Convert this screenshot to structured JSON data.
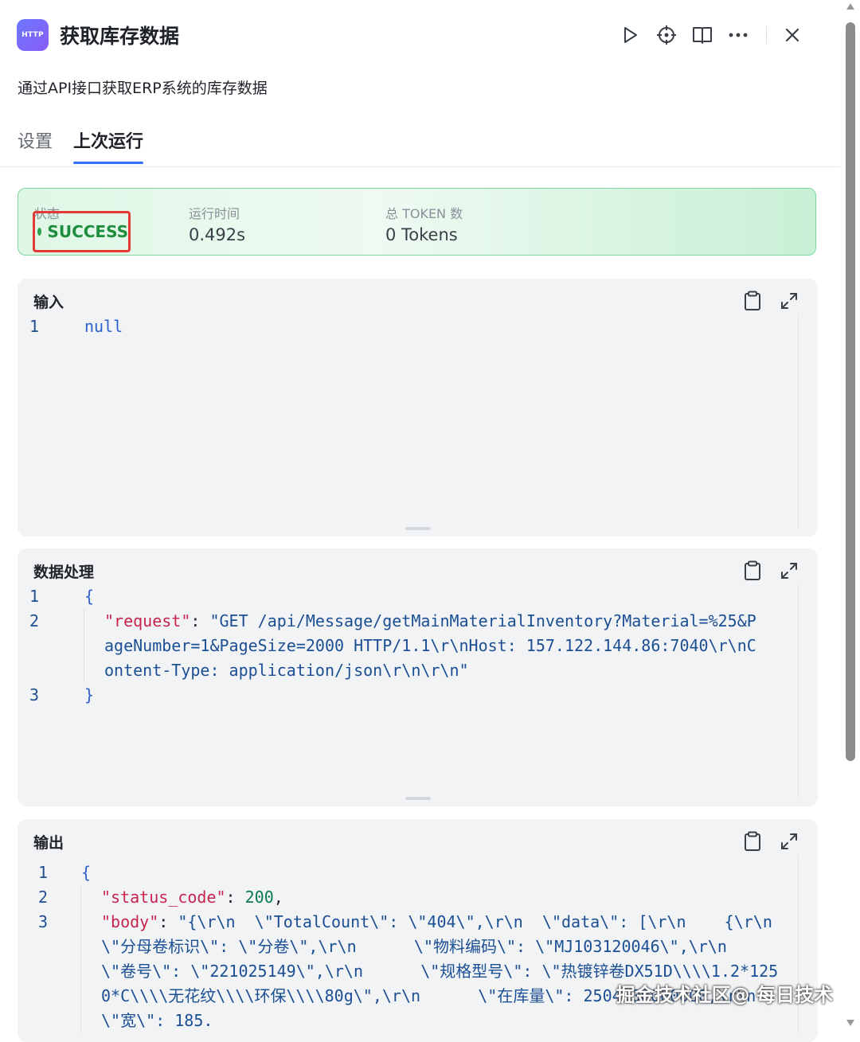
{
  "header": {
    "app_icon_text": "HTTP",
    "title": "获取库存数据",
    "subtitle": "通过API接口获取ERP系统的库存数据",
    "toolbar_icons": [
      "play-icon",
      "debug-target-icon",
      "book-icon",
      "more-icon",
      "close-icon"
    ]
  },
  "tabs": [
    {
      "label": "设置",
      "active": false
    },
    {
      "label": "上次运行",
      "active": true
    }
  ],
  "status": {
    "status_label": "状态",
    "status_value": "SUCCESS",
    "time_label": "运行时间",
    "time_value": "0.492s",
    "token_label": "总 TOKEN 数",
    "token_value": "0 Tokens",
    "colors": {
      "success": "#1e8e3e",
      "highlight_box": "#e53935",
      "accent": "#3370ff"
    }
  },
  "panels": {
    "input": {
      "title": "输入",
      "lines": [
        {
          "num": "1",
          "text": "null"
        }
      ]
    },
    "processing": {
      "title": "数据处理",
      "line1_num": "1",
      "line1_text": "{",
      "line2_num": "2",
      "request_key": "\"request\"",
      "colon": ": ",
      "request_value": "\"GET /api/Message/getMainMaterialInventory?Material=%25&PageNumber=1&PageSize=2000 HTTP/1.1\\r\\nHost: 157.122.144.86:7040\\r\\nContent-Type: application/json\\r\\n\\r\\n\"",
      "line3_num": "3",
      "line3_text": "}"
    },
    "output": {
      "title": "输出",
      "line1_num": "1",
      "line1_text": "{",
      "line2_num": "2",
      "status_code_key": "\"status_code\"",
      "status_code_value": "200",
      "line3_num": "3",
      "body_key": "\"body\"",
      "body_value": "\"{\\r\\n  \\\"TotalCount\\\": \\\"404\\\",\\r\\n  \\\"data\\\": [\\r\\n    {\\r\\n      \\\"分母卷标识\\\": \\\"分卷\\\",\\r\\n      \\\"物料编码\\\": \\\"MJ103120046\\\",\\r\\n      \\\"卷号\\\": \\\"221025149\\\",\\r\\n      \\\"规格型号\\\": \\\"热镀锌卷DX51D\\\\\\\\1.2*1250*C\\\\\\\\无花纹\\\\\\\\环保\\\\\\\\80g\\\",\\r\\n      \\\"在库量\\\": 2504.00000000,\\r\\n      \\\"宽\\\": 185."
    }
  },
  "watermark": "掘金技术社区@ 每日技术"
}
